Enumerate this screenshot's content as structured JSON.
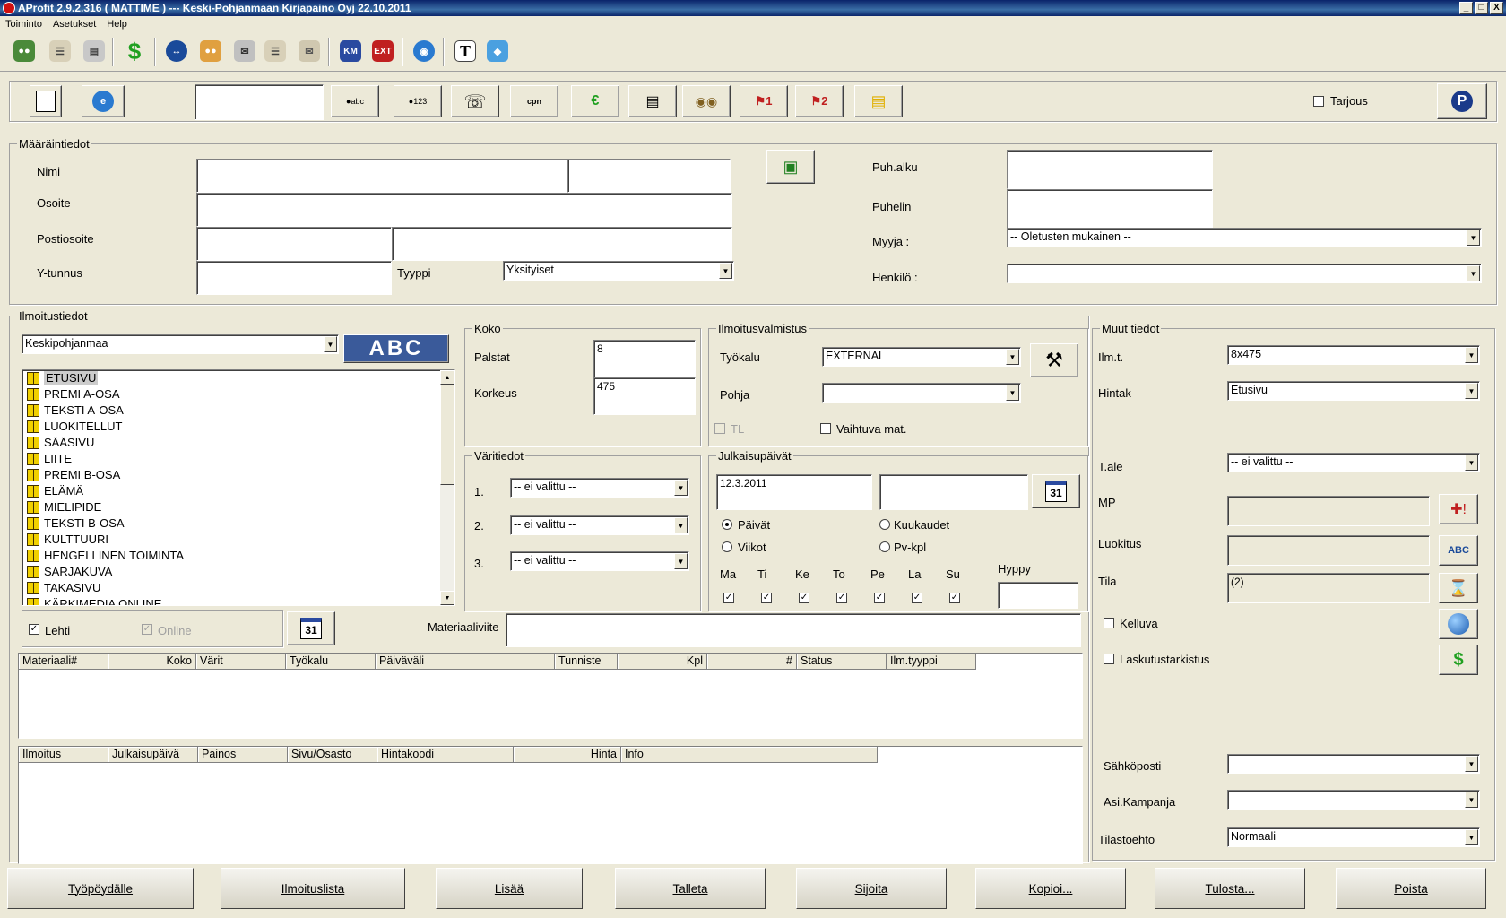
{
  "window": {
    "title": "AProfit 2.9.2.316 ( MATTIME ) --- Keski-Pohjanmaan Kirjapaino Oyj 22.10.2011",
    "min": "_",
    "max": "□",
    "close": "X"
  },
  "menu": [
    "Toiminto",
    "Asetukset",
    "Help"
  ],
  "toolbar2": {
    "search_value": "",
    "tarjous": "Tarjous"
  },
  "maarain": {
    "title": "Määräintiedot",
    "nimi": "Nimi",
    "osoite": "Osoite",
    "postiosoite": "Postiosoite",
    "ytunnus": "Y-tunnus",
    "tyyppi_label": "Tyyppi",
    "tyyppi_value": "Yksityiset",
    "puhalku": "Puh.alku",
    "puhelin": "Puhelin",
    "myyja_label": "Myyjä :",
    "myyja_value": "-- Oletusten mukainen --",
    "henkilo_label": "Henkilö :"
  },
  "ilmoitus": {
    "title": "Ilmoitustiedot",
    "publication": "Keskipohjanmaa",
    "sections": [
      "ETUSIVU",
      "PREMI A-OSA",
      "TEKSTI A-OSA",
      "LUOKITELLUT",
      "SÄÄSIVU",
      "LIITE",
      "PREMI B-OSA",
      "ELÄMÄ",
      "MIELIPIDE",
      "TEKSTI B-OSA",
      "KULTTUURI",
      "HENGELLINEN TOIMINTA",
      "SARJAKUVA",
      "TAKASIVU",
      "KÄRKIMEDIA ONLINE"
    ],
    "lehti": "Lehti",
    "online": "Online",
    "materiaaliviite": "Materiaaliviite"
  },
  "koko": {
    "title": "Koko",
    "palstat": "Palstat",
    "palstat_value": "8",
    "korkeus": "Korkeus",
    "korkeus_value": "475"
  },
  "varit": {
    "title": "Väritiedot",
    "rows": [
      {
        "n": "1.",
        "v": "-- ei valittu --"
      },
      {
        "n": "2.",
        "v": "-- ei valittu --"
      },
      {
        "n": "3.",
        "v": "-- ei valittu --"
      }
    ]
  },
  "valmistus": {
    "title": "Ilmoitusvalmistus",
    "tyokalu": "Työkalu",
    "tyokalu_value": "EXTERNAL",
    "pohja": "Pohja",
    "tl": "TL",
    "vaihtuva": "Vaihtuva mat."
  },
  "julkaisu": {
    "title": "Julkaisupäivät",
    "date1": "12.3.2011",
    "paivat": "Päivät",
    "viikot": "Viikot",
    "kuukaudet": "Kuukaudet",
    "pvkpl": "Pv-kpl",
    "hyppy": "Hyppy",
    "days": [
      "Ma",
      "Ti",
      "Ke",
      "To",
      "Pe",
      "La",
      "Su"
    ],
    "calendar": "31"
  },
  "muut": {
    "title": "Muut tiedot",
    "ilmt": "Ilm.t.",
    "ilmt_value": "8x475",
    "hintak": "Hintak",
    "hintak_value": "Etusivu",
    "tale": "T.ale",
    "tale_value": "-- ei valittu --",
    "mp": "MP",
    "luokitus": "Luokitus",
    "tila": "Tila",
    "tila_value": "(2)",
    "kelluva": "Kelluva",
    "laskutus": "Laskutustarkistus",
    "sahkoposti": "Sähköposti",
    "asikampanja": "Asi.Kampanja",
    "tilastoehto": "Tilastoehto",
    "tilastoehto_value": "Normaali"
  },
  "grid1": [
    "Materiaali#",
    "Koko",
    "Värit",
    "Työkalu",
    "Päiväväli",
    "Tunniste",
    "Kpl",
    "#",
    "Status",
    "Ilm.tyyppi"
  ],
  "grid2": [
    "Ilmoitus",
    "Julkaisupäivä",
    "Painos",
    "Sivu/Osasto",
    "Hintakoodi",
    "Hinta",
    "Info"
  ],
  "buttons": [
    "Työpöydälle",
    "Ilmoituslista",
    "Lisää",
    "Talleta",
    "Sijoita",
    "Kopioi...",
    "Tulosta...",
    "Poista"
  ],
  "colors": {
    "titlebar": "#0a246a",
    "face": "#ece9d8"
  }
}
